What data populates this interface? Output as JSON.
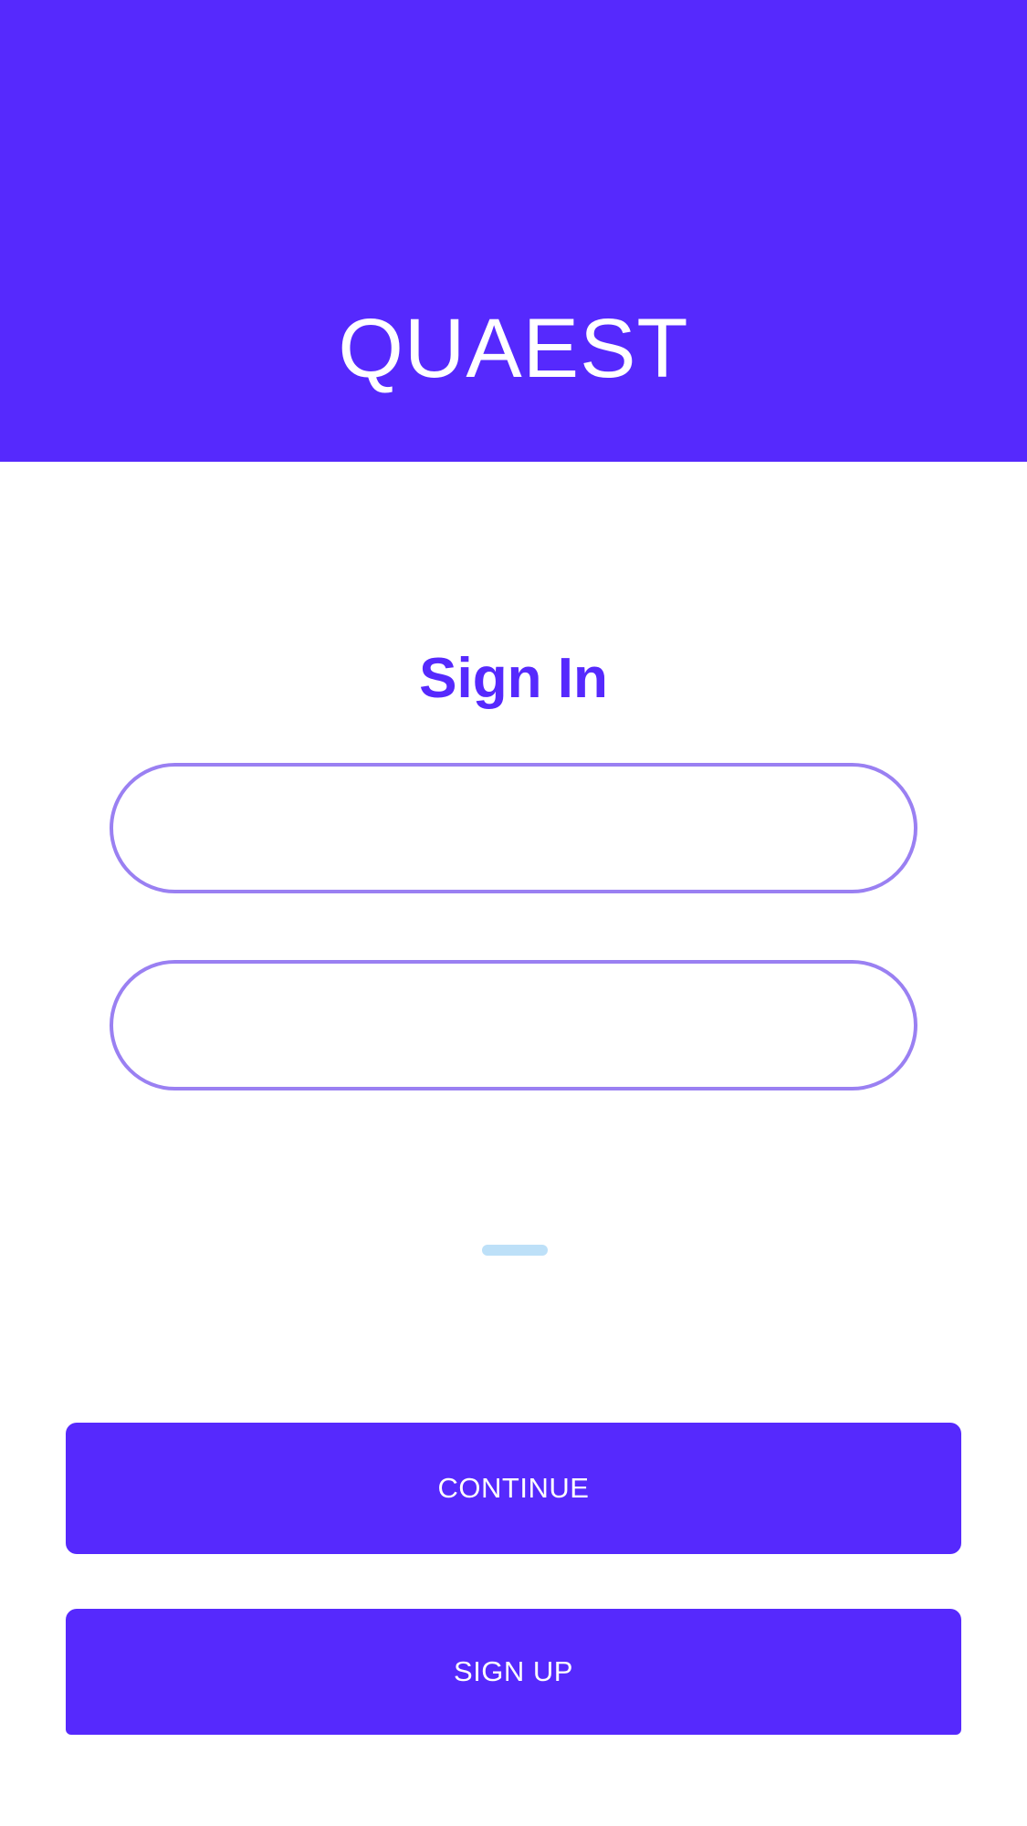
{
  "app": {
    "title": "QUAEST"
  },
  "form": {
    "heading": "Sign In",
    "username": {
      "value": "",
      "placeholder": ""
    },
    "password": {
      "value": "",
      "placeholder": ""
    }
  },
  "actions": {
    "continue_label": "CONTINUE",
    "signup_label": "SIGN UP"
  },
  "colors": {
    "brand": "#5629FD",
    "field_border": "#9A80F2",
    "loader": "#BDE0F8",
    "background": "#FFFFFF"
  }
}
